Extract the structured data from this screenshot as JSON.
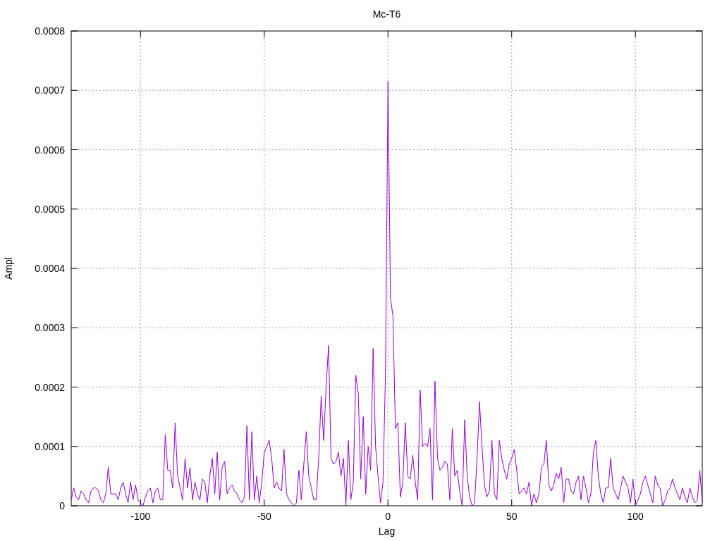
{
  "chart_data": {
    "type": "line",
    "title": "Mc-T6",
    "xlabel": "Lag",
    "ylabel": "Ampl",
    "grid": true,
    "xlim": [
      -128,
      127
    ],
    "ylim": [
      0,
      0.0008
    ],
    "xticks": [
      -100,
      -50,
      0,
      50,
      100
    ],
    "yticks": [
      {
        "value": 0,
        "label": "0"
      },
      {
        "value": 0.0001,
        "label": "0.0001"
      },
      {
        "value": 0.0002,
        "label": "0.0002"
      },
      {
        "value": 0.0003,
        "label": "0.0003"
      },
      {
        "value": 0.0004,
        "label": "0.0004"
      },
      {
        "value": 0.0005,
        "label": "0.0005"
      },
      {
        "value": 0.0006,
        "label": "0.0006"
      },
      {
        "value": 0.0007,
        "label": "0.0007"
      },
      {
        "value": 0.0008,
        "label": "0.0008"
      }
    ],
    "x": [
      -128,
      -127,
      -126,
      -125,
      -124,
      -123,
      -122,
      -121,
      -120,
      -119,
      -118,
      -117,
      -116,
      -115,
      -114,
      -113,
      -112,
      -111,
      -110,
      -109,
      -108,
      -107,
      -106,
      -105,
      -104,
      -103,
      -102,
      -101,
      -100,
      -99,
      -98,
      -97,
      -96,
      -95,
      -94,
      -93,
      -92,
      -91,
      -90,
      -89,
      -88,
      -87,
      -86,
      -85,
      -84,
      -83,
      -82,
      -81,
      -80,
      -79,
      -78,
      -77,
      -76,
      -75,
      -74,
      -73,
      -72,
      -71,
      -70,
      -69,
      -68,
      -67,
      -66,
      -65,
      -64,
      -63,
      -62,
      -61,
      -60,
      -59,
      -58,
      -57,
      -56,
      -55,
      -54,
      -53,
      -52,
      -51,
      -50,
      -49,
      -48,
      -47,
      -46,
      -45,
      -44,
      -43,
      -42,
      -41,
      -40,
      -39,
      -38,
      -37,
      -36,
      -35,
      -34,
      -33,
      -32,
      -31,
      -30,
      -29,
      -28,
      -27,
      -26,
      -25,
      -24,
      -23,
      -22,
      -21,
      -20,
      -19,
      -18,
      -17,
      -16,
      -15,
      -14,
      -13,
      -12,
      -11,
      -10,
      -9,
      -8,
      -7,
      -6,
      -5,
      -4,
      -3,
      -2,
      -1,
      0,
      1,
      2,
      3,
      4,
      5,
      6,
      7,
      8,
      9,
      10,
      11,
      12,
      13,
      14,
      15,
      16,
      17,
      18,
      19,
      20,
      21,
      22,
      23,
      24,
      25,
      26,
      27,
      28,
      29,
      30,
      31,
      32,
      33,
      34,
      35,
      36,
      37,
      38,
      39,
      40,
      41,
      42,
      43,
      44,
      45,
      46,
      47,
      48,
      49,
      50,
      51,
      52,
      53,
      54,
      55,
      56,
      57,
      58,
      59,
      60,
      61,
      62,
      63,
      64,
      65,
      66,
      67,
      68,
      69,
      70,
      71,
      72,
      73,
      74,
      75,
      76,
      77,
      78,
      79,
      80,
      81,
      82,
      83,
      84,
      85,
      86,
      87,
      88,
      89,
      90,
      91,
      92,
      93,
      94,
      95,
      96,
      97,
      98,
      99,
      100,
      101,
      102,
      103,
      104,
      105,
      106,
      107,
      108,
      109,
      110,
      111,
      112,
      113,
      114,
      115,
      116,
      117,
      118,
      119,
      120,
      121,
      122,
      123,
      124,
      125,
      126,
      127
    ],
    "series": [
      {
        "color": "#9400d3",
        "values": [
          1e-05,
          3e-05,
          1.5e-05,
          1e-05,
          2.5e-05,
          2e-05,
          1e-05,
          5e-06,
          2.5e-05,
          3e-05,
          3e-05,
          2.5e-05,
          1e-05,
          5e-06,
          2e-05,
          6.5e-05,
          2e-05,
          2e-05,
          2e-05,
          1e-05,
          3e-05,
          4e-05,
          2e-05,
          5e-06,
          4e-05,
          1e-05,
          3.5e-05,
          1e-05,
          5e-06,
          0,
          1.5e-05,
          2.5e-05,
          3e-05,
          5e-06,
          2.5e-05,
          3e-05,
          1e-05,
          1e-05,
          0.00012,
          6e-05,
          6e-05,
          3e-05,
          0.00014,
          5e-05,
          3e-05,
          1e-05,
          8e-05,
          3e-05,
          6.5e-05,
          1e-05,
          4e-05,
          2e-05,
          1e-05,
          4.5e-05,
          4e-05,
          5e-06,
          5e-05,
          8e-05,
          2e-05,
          9e-05,
          1e-05,
          6.5e-05,
          7.5e-05,
          2e-05,
          3e-05,
          3.5e-05,
          2.5e-05,
          2e-05,
          1e-05,
          5e-06,
          1.5e-05,
          0.000135,
          1e-05,
          0.000125,
          1e-05,
          5e-05,
          5e-06,
          4e-05,
          9e-05,
          0.0001,
          0.00011,
          8e-05,
          3e-05,
          4e-05,
          3e-05,
          2.5e-05,
          9.5e-05,
          2e-05,
          1e-05,
          5e-06,
          0,
          5e-06,
          6e-05,
          1e-05,
          7e-05,
          0.000125,
          5e-05,
          3e-05,
          1e-05,
          1e-05,
          8e-05,
          0.000185,
          0.00011,
          0.0002,
          0.00027,
          8e-05,
          7e-05,
          7.5e-05,
          9e-05,
          5e-05,
          8e-05,
          0,
          0.00011,
          1e-05,
          4e-05,
          0.00022,
          0.00019,
          4.5e-05,
          0.00015,
          2e-05,
          0.0001,
          6e-05,
          0.000265,
          0.0001,
          5e-05,
          5e-06,
          4e-05,
          0.00022,
          0.000715,
          0.00035,
          0.00032,
          0.00013,
          0.00014,
          1.5e-05,
          4e-05,
          0.00014,
          5e-05,
          4.5e-05,
          8.5e-05,
          4e-05,
          1e-05,
          0.000195,
          0.0001,
          0.000105,
          0.0001,
          0.00013,
          1e-05,
          0.00021,
          8e-05,
          6e-05,
          6.5e-05,
          7.5e-05,
          7e-05,
          1e-05,
          0.00013,
          5e-05,
          6e-05,
          2.5e-05,
          0,
          0.000145,
          5e-05,
          1.5e-05,
          0,
          5e-06,
          8e-05,
          0.000175,
          0.0001,
          3.5e-05,
          1.5e-05,
          2.5e-05,
          0.00011,
          2e-05,
          1e-05,
          0.00011,
          8e-05,
          6e-05,
          4.5e-05,
          7e-05,
          8e-05,
          9.5e-05,
          6e-05,
          2e-05,
          2.5e-05,
          3e-05,
          2e-05,
          4e-05,
          0,
          2e-05,
          5e-06,
          2e-05,
          6.5e-05,
          7e-05,
          0.00011,
          3.5e-05,
          2.5e-05,
          3.5e-05,
          5.5e-05,
          4.5e-05,
          6.5e-05,
          5e-06,
          4.5e-05,
          4.5e-05,
          2.5e-05,
          2e-05,
          4e-05,
          5e-05,
          1e-05,
          5e-05,
          3e-05,
          5e-06,
          2e-05,
          9e-05,
          0.00011,
          5e-05,
          2e-05,
          5e-06,
          3e-05,
          3e-05,
          8e-05,
          3e-05,
          2e-05,
          1e-05,
          3e-05,
          5e-05,
          4e-05,
          3e-05,
          5e-06,
          4.5e-05,
          0,
          1e-05,
          2e-05,
          4e-05,
          5e-05,
          3.5e-05,
          2e-05,
          5e-06,
          5e-05,
          3.5e-05,
          3e-05,
          0,
          1e-05,
          2.5e-05,
          3e-05,
          4.5e-05,
          3e-05,
          2e-05,
          1e-05,
          3e-05,
          1.5e-05,
          5e-06,
          3e-05,
          1.5e-05,
          5e-06,
          1e-05,
          6e-05,
          5e-06
        ]
      }
    ]
  }
}
